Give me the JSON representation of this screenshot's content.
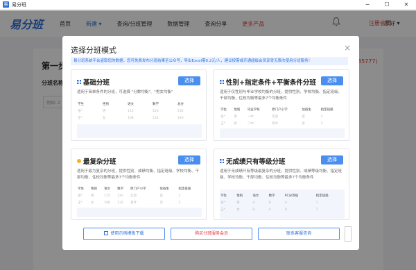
{
  "window": {
    "title": "易分班",
    "controls": [
      "─",
      "☐",
      "✕"
    ]
  },
  "header": {
    "brand": "易分班",
    "nav": [
      {
        "label": "首页",
        "active": false
      },
      {
        "label": "新建 ▾",
        "active": true
      },
      {
        "label": "查询/分班管理",
        "active": false
      },
      {
        "label": "数据管理",
        "active": false
      },
      {
        "label": "查询分享",
        "active": false
      },
      {
        "label": "更多产品",
        "red": true
      }
    ],
    "register": "注册会员",
    "greeting": "您好 ▾"
  },
  "background": {
    "step": "第一步",
    "label": "分班名称",
    "phone": "35777)",
    "row_text": "例如: 2"
  },
  "modal": {
    "title": "选择分班模式",
    "close": "×",
    "notice": "易分班系统不会盗取您的数据，您可免费发布分班结果至公众号，导出Excel需0.2元/人，建议按需或开通超级会员享受无限次使用分班服务！",
    "cards": [
      {
        "name": "基础分班",
        "icon": "grid-icon",
        "button": "选择",
        "desc": "适用于简单条件的分班，可选择 \"分数均衡\"、\"男女均衡\"",
        "columns": [
          "学生",
          "性别",
          "语文",
          "数学",
          "总分"
        ],
        "rows": [
          [
            "张*",
            "男",
            "115",
            "120",
            "235"
          ],
          [
            "王*",
            "女",
            "108",
            "132",
            "240"
          ]
        ]
      },
      {
        "name": "性别+指定条件+平衡条件分班",
        "icon": "grid-icon",
        "button": "选择",
        "desc": "适用于仅性别与毕业学校均衡的分班，提供性别、学校均衡、指定班级、干部均衡，住校均衡等最多7个均衡条件",
        "columns": [
          "学生",
          "性别",
          "毕业学校",
          "原门户小学",
          "住宿生",
          "指定班级"
        ],
        "rows": [
          [
            "张*",
            "男",
            "一中",
            "实验",
            "是",
            "1"
          ],
          [
            "王*",
            "女",
            "二中",
            "育才",
            "否",
            "2"
          ]
        ]
      },
      {
        "name": "最复杂分班",
        "icon": "bulb-icon",
        "button": "选择",
        "desc": "适用于最为复杂的分班，提供性别、成绩均衡、指定班级、学校均衡、干部均衡、住校均衡等最多7个均衡条件",
        "columns": [
          "学生",
          "性别",
          "语文",
          "数学",
          "原门户小学",
          "住宿生",
          "指定班级"
        ],
        "rows": [
          [
            "张*",
            "男",
            "115",
            "120",
            "实验",
            "是",
            "1"
          ],
          [
            "王*",
            "女",
            "108",
            "132",
            "育才",
            "否",
            "2"
          ]
        ]
      },
      {
        "name": "无成绩只有等级分班",
        "icon": "grid-icon",
        "button": "选择",
        "desc": "适用于无成绩只有等级最复杂的分班，提供性别、成绩等级均衡、指定班级、学校均衡、干部均衡、住校均衡等最多7个均衡条件",
        "columns": [
          "学生",
          "性别",
          "语文",
          "数学",
          "PC分等级",
          "指定班级"
        ],
        "rows": [
          [
            "张*",
            "男",
            "A",
            "B",
            "A",
            "1"
          ],
          [
            "王*",
            "女",
            "B",
            "A",
            "B",
            "2"
          ]
        ]
      }
    ],
    "footer": {
      "download": "使用示例模板下载",
      "buy": "购买分班服务会员",
      "contact": "联系客服咨询"
    }
  }
}
